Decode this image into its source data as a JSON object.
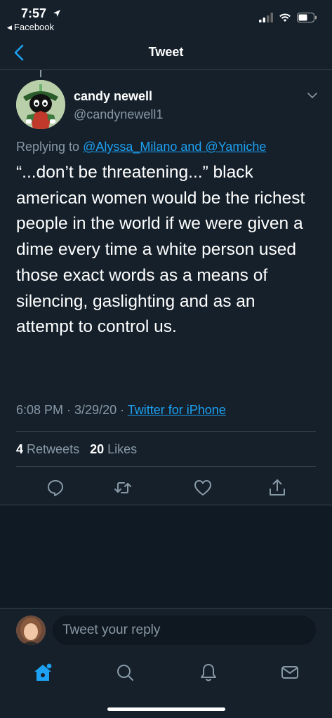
{
  "status_bar": {
    "time": "7:57",
    "back_app": "Facebook"
  },
  "nav": {
    "title": "Tweet"
  },
  "tweet": {
    "display_name": "candy newell",
    "handle": "@candynewell1",
    "replying_prefix": "Replying to ",
    "replying_to": "@Alyssa_Milano and @Yamiche",
    "text": "“...don’t be threatening...” black american women would be the richest people in the world if we were given a dime every time a white person used those exact words as a means of silencing, gaslighting and as an attempt to control us.",
    "timestamp": "6:08 PM · 3/29/20 · ",
    "source": "Twitter for iPhone",
    "retweets_count": "4",
    "retweets_label": "Retweets",
    "likes_count": "20",
    "likes_label": "Likes"
  },
  "reply": {
    "placeholder": "Tweet your reply"
  },
  "colors": {
    "background": "#15202b",
    "accent": "#1da1f2",
    "secondary_text": "#8899a6",
    "divider": "#38444d"
  },
  "icons": {
    "actions": [
      "reply-icon",
      "retweet-icon",
      "like-icon",
      "share-icon"
    ],
    "tabs": [
      "home-icon",
      "search-icon",
      "notifications-icon",
      "messages-icon"
    ]
  }
}
